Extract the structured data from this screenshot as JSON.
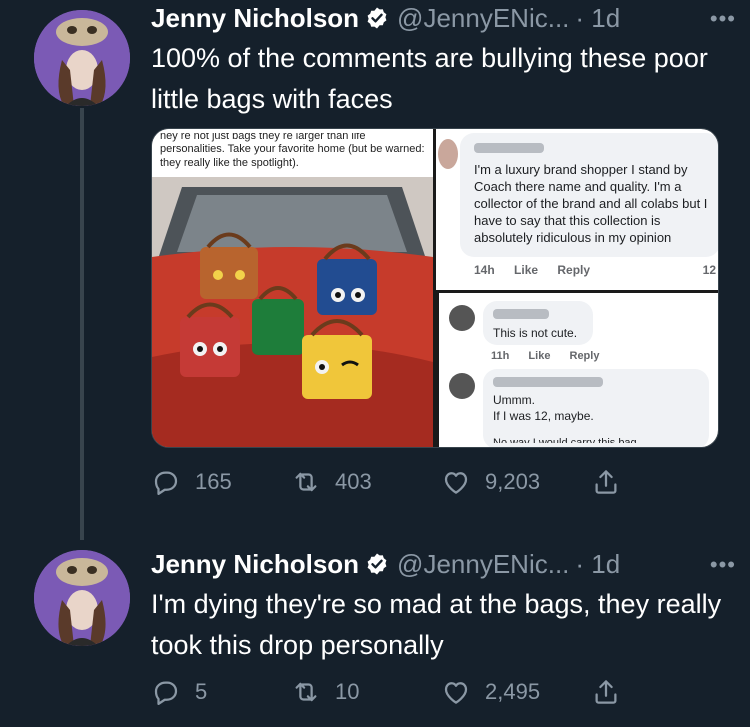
{
  "tweets": [
    {
      "name": "Jenny Nicholson",
      "handle": "@JennyENic...",
      "time": "· 1d",
      "more": "•••",
      "text": "100% of the comments are bullying these poor little bags with faces",
      "media": {
        "caption_cut": "ney re not just bags they re larger than life",
        "caption": "personalities. Take your favorite home (but be warned: they really like the spotlight).",
        "comments": [
          {
            "text": "I'm a luxury brand shopper I stand by Coach there name and quality. I'm a collector of the brand and all colabs but I have to say that this collection is absolutely ridiculous in my opinion",
            "time": "14h",
            "like": "Like",
            "reply": "Reply",
            "count": "12"
          },
          {
            "text": "This is not cute.",
            "time": "11h",
            "like": "Like",
            "reply": "Reply"
          },
          {
            "text_line1": "Ummm.",
            "text_line2": "If I was 12, maybe.",
            "text_line3": "No way I would carry this bag"
          }
        ]
      },
      "actions": {
        "replies": "165",
        "retweets": "403",
        "likes": "9,203"
      }
    },
    {
      "name": "Jenny Nicholson",
      "handle": "@JennyENic...",
      "time": "· 1d",
      "more": "•••",
      "text": "I'm dying they're so mad at the bags, they really took this drop personally",
      "actions": {
        "replies": "5",
        "retweets": "10",
        "likes": "2,495"
      }
    }
  ],
  "colors": {
    "background": "#15202b",
    "secondary_text": "#8b98a5",
    "verified": "#ffffff",
    "thread_line": "#38444d"
  }
}
